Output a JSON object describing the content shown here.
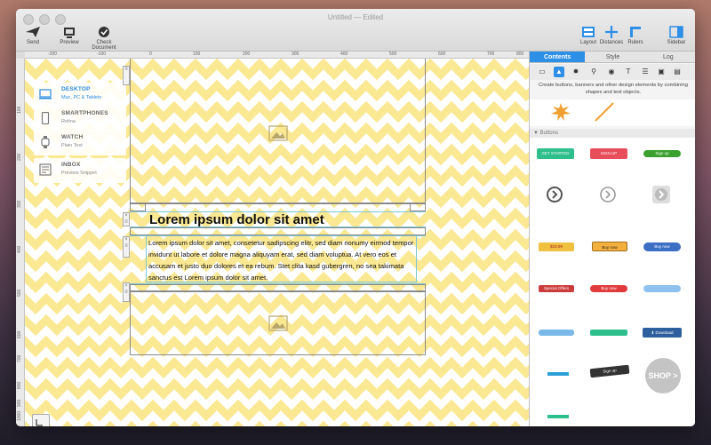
{
  "window": {
    "title": "Untitled",
    "edited": "— Edited"
  },
  "toolbar": {
    "send": "Send",
    "preview": "Preview",
    "check_document": "Check Document",
    "layout": "Layout",
    "distances": "Distances",
    "rulers": "Rulers",
    "sidebar": "Sidebar"
  },
  "ruler_ticks": {
    "top": [
      "-200",
      "-100",
      "0",
      "100",
      "200",
      "300",
      "400",
      "500",
      "600",
      "700",
      "800"
    ],
    "left": [
      "100",
      "200",
      "300",
      "400",
      "500",
      "600",
      "700",
      "800",
      "900",
      "1000"
    ]
  },
  "devices": [
    {
      "title": "DESKTOP",
      "sub": "Mac, PC & Tablets",
      "icon": "laptop-icon"
    },
    {
      "title": "SMARTPHONES",
      "sub": "Retina",
      "icon": "smartphone-icon"
    },
    {
      "title": "WATCH",
      "sub": "Plain Text",
      "icon": "watch-icon"
    },
    {
      "title": "INBOX",
      "sub": "Preview Snippet",
      "icon": "inbox-icon"
    }
  ],
  "canvas": {
    "heading": "Lorem ipsum dolor sit amet",
    "body": "Lorem ipsum dolor sit amet, consetetur sadipscing elitr, sed diam nonumy eirmod tempor invidunt ut labore et dolore magna aliquyam erat, sed diam voluptua. At vero eos et accusam et justo duo dolores et ea rebum. Stet clita kasd gubergren, no sea takimata sanctus est Lorem ipsum dolor sit amet."
  },
  "panel": {
    "tabs": [
      "Contents",
      "Style",
      "Log"
    ],
    "hint": "Create buttons, banners and other design elements by combining shapes and text objects.",
    "section": "Buttons",
    "buttons": [
      "GET STARTED",
      "SIGN UP",
      "Sign up",
      "Buy now",
      "Buy now",
      "Special Offers",
      "Buy now",
      "Download",
      "Sign up",
      "SHOP >",
      "$19.99"
    ]
  },
  "colors": {
    "accent": "#2e8fe6",
    "canvas_yellow": "#fbe893"
  }
}
